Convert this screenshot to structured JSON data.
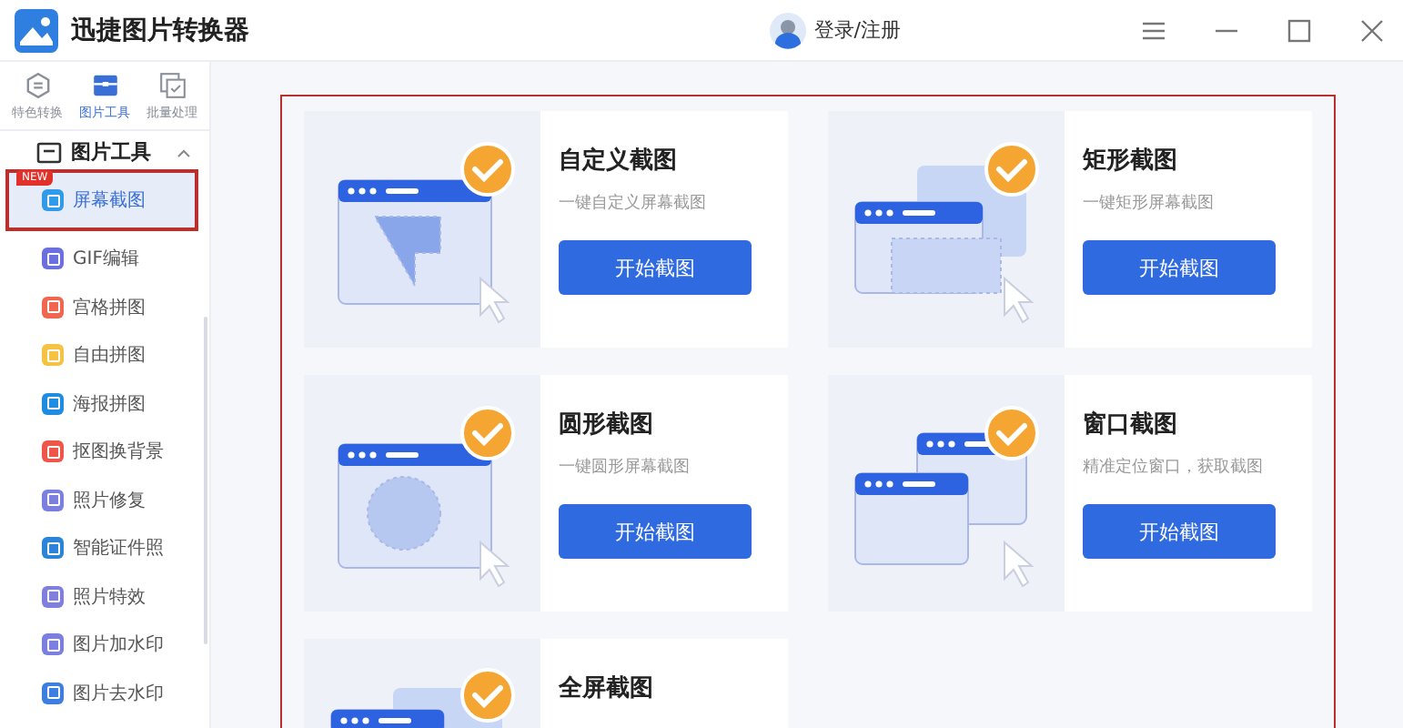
{
  "window": {
    "title": "迅捷图片转换器",
    "login": "登录/注册"
  },
  "nav_tabs": [
    {
      "label": "特色转换",
      "selected": false,
      "kind": "convert"
    },
    {
      "label": "图片工具",
      "selected": true,
      "kind": "tools"
    },
    {
      "label": "批量处理",
      "selected": false,
      "kind": "batch"
    }
  ],
  "group": {
    "label": "图片工具",
    "expanded": true
  },
  "items": [
    {
      "label": "屏幕截图",
      "selected": true,
      "badge": "NEW",
      "color": "#2f9bea"
    },
    {
      "label": "GIF编辑",
      "selected": false,
      "color": "#6c6fe0"
    },
    {
      "label": "宫格拼图",
      "selected": false,
      "color": "#f0664f"
    },
    {
      "label": "自由拼图",
      "selected": false,
      "color": "#f5c242"
    },
    {
      "label": "海报拼图",
      "selected": false,
      "color": "#1e8ce0"
    },
    {
      "label": "抠图换背景",
      "selected": false,
      "color": "#ef5548"
    },
    {
      "label": "照片修复",
      "selected": false,
      "color": "#7b7fe0"
    },
    {
      "label": "智能证件照",
      "selected": false,
      "color": "#2b84d8"
    },
    {
      "label": "照片特效",
      "selected": false,
      "color": "#8080dc"
    },
    {
      "label": "图片加水印",
      "selected": false,
      "color": "#7b7fe0"
    },
    {
      "label": "图片去水印",
      "selected": false,
      "color": "#3d7fe0"
    }
  ],
  "cards": [
    {
      "kind": "custom",
      "title": "自定义截图",
      "subtitle": "一键自定义屏幕截图",
      "button": "开始截图"
    },
    {
      "kind": "rect",
      "title": "矩形截图",
      "subtitle": "一键矩形屏幕截图",
      "button": "开始截图"
    },
    {
      "kind": "circle",
      "title": "圆形截图",
      "subtitle": "一键圆形屏幕截图",
      "button": "开始截图"
    },
    {
      "kind": "window",
      "title": "窗口截图",
      "subtitle": "精准定位窗口，获取截图",
      "button": "开始截图"
    },
    {
      "kind": "full",
      "title": "全屏截图"
    }
  ]
}
